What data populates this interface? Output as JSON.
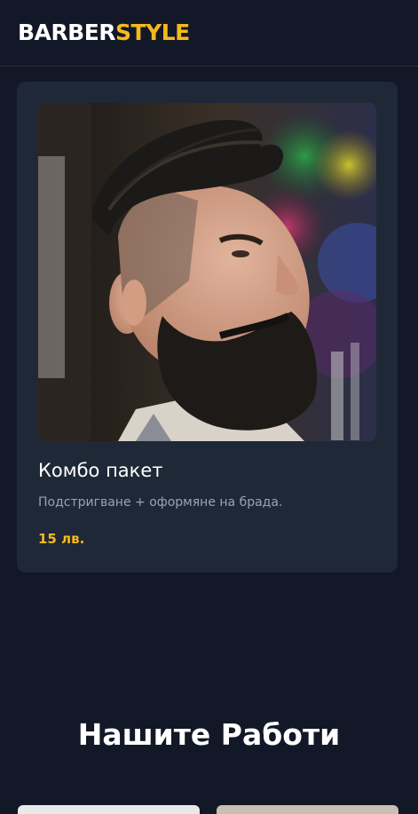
{
  "header": {
    "logo_part1": "BARBER",
    "logo_part2": "STYLE"
  },
  "service_card": {
    "title": "Комбо пакет",
    "description": "Подстригване + оформяне на брада.",
    "price": "15 лв."
  },
  "works_section": {
    "title": "Нашите Работи"
  },
  "colors": {
    "background": "#121827",
    "card": "#1f2837",
    "accent": "#f5b91c",
    "muted_text": "#9aa3b1"
  }
}
